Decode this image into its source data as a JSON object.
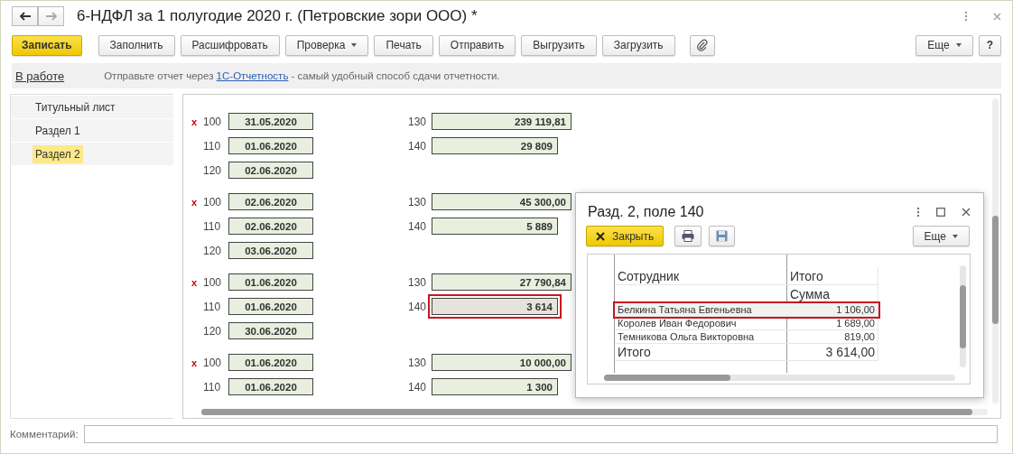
{
  "window": {
    "title": "6-НДФЛ за 1 полугодие 2020 г. (Петровские зори ООО) *"
  },
  "toolbar": {
    "buttons": [
      {
        "label": "Записать",
        "kind": "primary"
      },
      {
        "label": "Заполнить",
        "kind": "plain"
      },
      {
        "label": "Расшифровать",
        "kind": "plain"
      },
      {
        "label": "Проверка",
        "kind": "dropdown"
      },
      {
        "label": "Печать",
        "kind": "plain"
      },
      {
        "label": "Отправить",
        "kind": "plain"
      },
      {
        "label": "Выгрузить",
        "kind": "plain"
      },
      {
        "label": "Загрузить",
        "kind": "plain"
      },
      {
        "kind": "attach"
      }
    ],
    "right_buttons": [
      {
        "label": "Еще",
        "kind": "dropdown"
      },
      {
        "label": "?",
        "kind": "plain"
      }
    ]
  },
  "status": {
    "state": "В работе",
    "message_before": "Отправьте отчет через",
    "link": "1С-Отчетность",
    "message_after": "- самый удобный способ сдачи отчетности."
  },
  "sidebar": {
    "items": [
      {
        "label": "Титульный лист",
        "selected": false
      },
      {
        "label": "Раздел 1",
        "selected": false
      },
      {
        "label": "Раздел 2",
        "selected": true
      }
    ]
  },
  "groups": [
    {
      "flag": "x",
      "left": [
        {
          "code": "100",
          "value": "31.05.2020"
        },
        {
          "code": "110",
          "value": "01.06.2020"
        },
        {
          "code": "120",
          "value": "02.06.2020"
        }
      ],
      "right": [
        {
          "code": "130",
          "value": "239 119,81",
          "highlighted": false
        },
        {
          "code": "140",
          "value": "29 809",
          "highlighted": false
        }
      ]
    },
    {
      "flag": "x",
      "left": [
        {
          "code": "100",
          "value": "02.06.2020"
        },
        {
          "code": "110",
          "value": "02.06.2020"
        },
        {
          "code": "120",
          "value": "03.06.2020"
        }
      ],
      "right": [
        {
          "code": "130",
          "value": "45 300,00",
          "highlighted": false
        },
        {
          "code": "140",
          "value": "5 889",
          "highlighted": false
        }
      ]
    },
    {
      "flag": "x",
      "left": [
        {
          "code": "100",
          "value": "01.06.2020"
        },
        {
          "code": "110",
          "value": "01.06.2020"
        },
        {
          "code": "120",
          "value": "30.06.2020"
        }
      ],
      "right": [
        {
          "code": "130",
          "value": "27 790,84",
          "highlighted": false
        },
        {
          "code": "140",
          "value": "3 614",
          "highlighted": true
        }
      ]
    },
    {
      "flag": "x",
      "left": [
        {
          "code": "100",
          "value": "01.06.2020"
        },
        {
          "code": "110",
          "value": "01.06.2020"
        }
      ],
      "right": [
        {
          "code": "130",
          "value": "10 000,00",
          "highlighted": false
        },
        {
          "code": "140",
          "value": "1 300",
          "highlighted": false
        }
      ]
    }
  ],
  "dialog": {
    "title": "Разд. 2, поле 140",
    "buttons": [
      {
        "label": "Закрыть",
        "kind": "close"
      },
      {
        "kind": "print"
      },
      {
        "kind": "save"
      },
      {
        "label": "Еще",
        "kind": "dropdown"
      }
    ],
    "report": {
      "columns": [
        "Сотрудник",
        "Итого"
      ],
      "subheader": "Сумма",
      "rows": [
        {
          "name": "Белкина Татьяна Евгеньевна",
          "amount": "1 106,00",
          "selected": true
        },
        {
          "name": "Королев Иван Федорович",
          "amount": "1 689,00",
          "selected": false
        },
        {
          "name": "Темникова Ольга Викторовна",
          "amount": "819,00",
          "selected": false
        }
      ],
      "total": {
        "label": "Итого",
        "amount": "3 614,00"
      }
    }
  },
  "comment": {
    "label": "Комментарий:"
  }
}
